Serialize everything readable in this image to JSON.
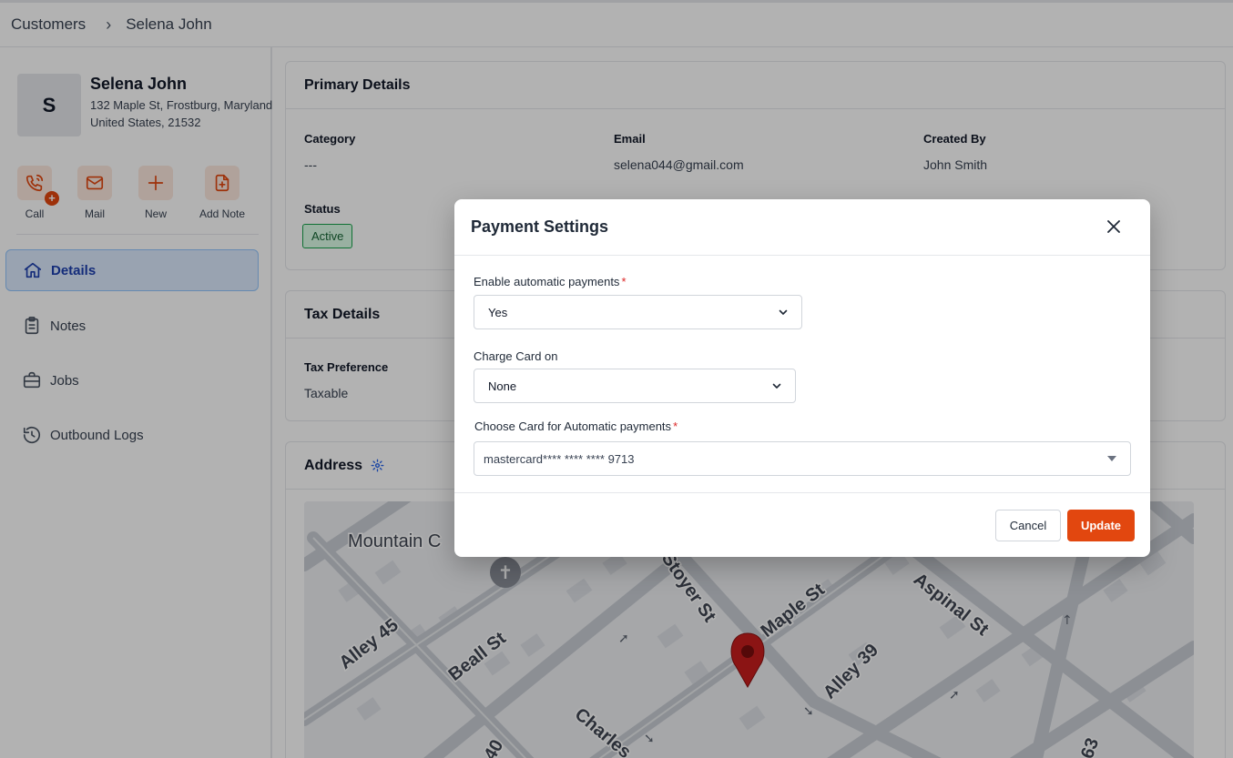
{
  "breadcrumb": {
    "root": "Customers",
    "separator": "›",
    "current": "Selena John"
  },
  "customer": {
    "initial": "S",
    "name": "Selena John",
    "address_line1": "132 Maple St, Frostburg, Maryland",
    "address_line2": "United States, 21532"
  },
  "actions": [
    {
      "label": "Call",
      "icon": "phone-plus-icon"
    },
    {
      "label": "Mail",
      "icon": "mail-icon"
    },
    {
      "label": "New",
      "icon": "plus-icon"
    },
    {
      "label": "Add Note",
      "icon": "note-add-icon"
    }
  ],
  "nav": [
    {
      "label": "Details",
      "icon": "home-icon",
      "active": true
    },
    {
      "label": "Notes",
      "icon": "clipboard-icon",
      "active": false
    },
    {
      "label": "Jobs",
      "icon": "briefcase-icon",
      "active": false
    },
    {
      "label": "Outbound Logs",
      "icon": "history-icon",
      "active": false
    }
  ],
  "primary": {
    "title": "Primary Details",
    "category_label": "Category",
    "category_value": "---",
    "email_label": "Email",
    "email_value": "selena044@gmail.com",
    "created_label": "Created By",
    "created_value": "John Smith",
    "status_label": "Status",
    "status_value": "Active"
  },
  "tax": {
    "title": "Tax Details",
    "pref_label": "Tax Preference",
    "pref_value": "Taxable"
  },
  "address": {
    "title": "Address",
    "icon": "gear-icon"
  },
  "map": {
    "labels": [
      "Mountain C",
      "Alley 45",
      "Beall St",
      "Stoyer St",
      "Maple St",
      "Aspinal St",
      "Alley 39",
      "Charles",
      "40",
      "63"
    ]
  },
  "modal": {
    "title": "Payment Settings",
    "auto_label": "Enable automatic payments",
    "auto_value": "Yes",
    "charge_label": "Charge Card on",
    "charge_value": "None",
    "card_label": "Choose Card for Automatic payments",
    "card_value": "mastercard**** **** **** 9713",
    "required_mark": "*",
    "cancel": "Cancel",
    "update": "Update"
  },
  "colors": {
    "accent": "#e2470f",
    "active_nav_bg": "#dbeafe",
    "status_green": "#16a34a",
    "map_pin": "#c81e1e"
  }
}
